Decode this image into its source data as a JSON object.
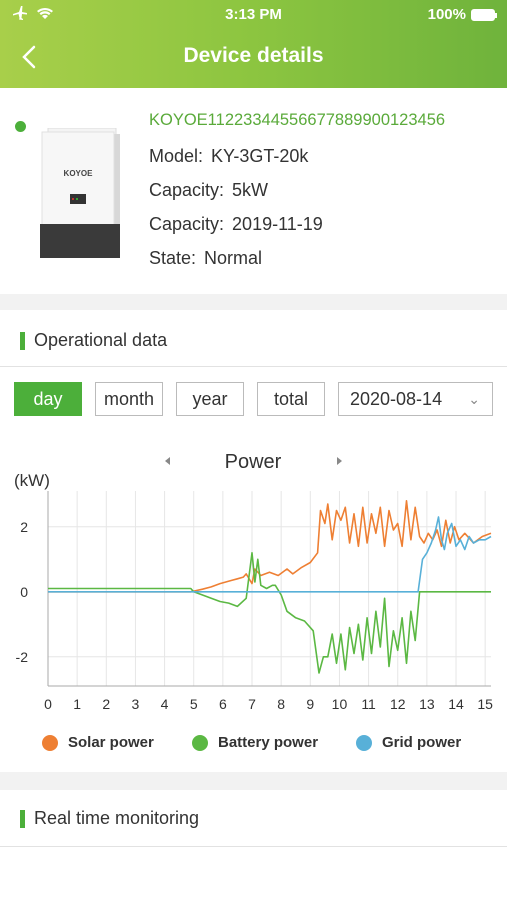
{
  "status_bar": {
    "time": "3:13 PM",
    "battery": "100%"
  },
  "header": {
    "title": "Device details"
  },
  "device": {
    "serial": "KOYOE11223344556677889900123456",
    "brand_logo": "KOYOE",
    "model_label": "Model:",
    "model": "KY-3GT-20k",
    "capacity_label": "Capacity:",
    "capacity": "5kW",
    "date_label": "Capacity:",
    "date": "2019-11-19",
    "state_label": "State:",
    "state": "Normal"
  },
  "operational": {
    "title": "Operational data",
    "tabs": [
      {
        "label": "day"
      },
      {
        "label": "month"
      },
      {
        "label": "year"
      },
      {
        "label": "total"
      }
    ],
    "date": "2020-08-14"
  },
  "chart_data": {
    "type": "line",
    "title": "Power",
    "ylabel": "(kW)",
    "xlim": [
      0,
      15.2
    ],
    "ylim": [
      -2.9,
      3.1
    ],
    "xticks": [
      0,
      1,
      2,
      3,
      4,
      5,
      6,
      7,
      8,
      9,
      10,
      11,
      12,
      13,
      14,
      15
    ],
    "yticks": [
      2,
      0,
      -2
    ],
    "grid": true,
    "legend": "bottom",
    "series": [
      {
        "name": "Solar power",
        "color": "#ee7f33",
        "points": [
          [
            0,
            0
          ],
          [
            4.9,
            0
          ],
          [
            5.0,
            0.02
          ],
          [
            5.3,
            0.08
          ],
          [
            5.6,
            0.15
          ],
          [
            5.9,
            0.25
          ],
          [
            6.1,
            0.3
          ],
          [
            6.3,
            0.35
          ],
          [
            6.5,
            0.4
          ],
          [
            6.7,
            0.45
          ],
          [
            6.8,
            0.55
          ],
          [
            7.0,
            0.25
          ],
          [
            7.1,
            0.7
          ],
          [
            7.3,
            0.5
          ],
          [
            7.6,
            0.6
          ],
          [
            7.9,
            0.5
          ],
          [
            8.2,
            0.7
          ],
          [
            8.4,
            0.55
          ],
          [
            8.7,
            0.75
          ],
          [
            9.0,
            0.9
          ],
          [
            9.25,
            1.2
          ],
          [
            9.35,
            2.5
          ],
          [
            9.5,
            2.1
          ],
          [
            9.6,
            2.7
          ],
          [
            9.75,
            1.6
          ],
          [
            9.9,
            2.5
          ],
          [
            10.05,
            2.2
          ],
          [
            10.2,
            2.6
          ],
          [
            10.35,
            1.5
          ],
          [
            10.5,
            2.4
          ],
          [
            10.65,
            1.4
          ],
          [
            10.8,
            2.6
          ],
          [
            10.95,
            1.5
          ],
          [
            11.1,
            2.4
          ],
          [
            11.25,
            1.8
          ],
          [
            11.4,
            2.6
          ],
          [
            11.55,
            1.4
          ],
          [
            11.7,
            2.5
          ],
          [
            11.85,
            1.9
          ],
          [
            12.0,
            2.1
          ],
          [
            12.15,
            1.4
          ],
          [
            12.3,
            2.8
          ],
          [
            12.45,
            1.6
          ],
          [
            12.6,
            2.6
          ],
          [
            12.75,
            1.7
          ],
          [
            12.9,
            1.5
          ],
          [
            13.05,
            1.8
          ],
          [
            13.2,
            1.6
          ],
          [
            13.35,
            1.9
          ],
          [
            13.5,
            1.4
          ],
          [
            13.65,
            2.2
          ],
          [
            13.8,
            1.5
          ],
          [
            13.95,
            2.0
          ],
          [
            14.1,
            1.6
          ],
          [
            14.3,
            1.8
          ],
          [
            14.6,
            1.5
          ],
          [
            14.9,
            1.7
          ],
          [
            15.2,
            1.8
          ]
        ]
      },
      {
        "name": "Battery power",
        "color": "#5bb843",
        "points": [
          [
            0,
            0.1
          ],
          [
            4.9,
            0.1
          ],
          [
            5.0,
            0
          ],
          [
            5.3,
            -0.1
          ],
          [
            5.6,
            -0.2
          ],
          [
            5.9,
            -0.3
          ],
          [
            6.2,
            -0.35
          ],
          [
            6.5,
            -0.45
          ],
          [
            6.8,
            -0.2
          ],
          [
            7.0,
            1.2
          ],
          [
            7.1,
            0.3
          ],
          [
            7.2,
            1.0
          ],
          [
            7.3,
            0.2
          ],
          [
            7.5,
            0.1
          ],
          [
            7.7,
            0.2
          ],
          [
            7.8,
            0.2
          ],
          [
            8.0,
            -0.1
          ],
          [
            8.2,
            -0.6
          ],
          [
            8.5,
            -0.8
          ],
          [
            8.8,
            -0.9
          ],
          [
            9.1,
            -1.2
          ],
          [
            9.3,
            -2.5
          ],
          [
            9.45,
            -2.0
          ],
          [
            9.6,
            -2.0
          ],
          [
            9.75,
            -1.3
          ],
          [
            9.9,
            -2.2
          ],
          [
            10.05,
            -1.3
          ],
          [
            10.2,
            -2.4
          ],
          [
            10.35,
            -1.1
          ],
          [
            10.5,
            -1.9
          ],
          [
            10.65,
            -1.0
          ],
          [
            10.8,
            -2.1
          ],
          [
            10.95,
            -0.8
          ],
          [
            11.1,
            -1.9
          ],
          [
            11.25,
            -0.6
          ],
          [
            11.4,
            -1.7
          ],
          [
            11.55,
            -0.2
          ],
          [
            11.7,
            -2.3
          ],
          [
            11.85,
            -1.2
          ],
          [
            12.0,
            -1.8
          ],
          [
            12.15,
            -0.8
          ],
          [
            12.3,
            -2.2
          ],
          [
            12.45,
            -0.6
          ],
          [
            12.6,
            -1.5
          ],
          [
            12.75,
            0
          ],
          [
            15.2,
            0
          ]
        ]
      },
      {
        "name": "Grid power",
        "color": "#58b0d8",
        "points": [
          [
            0,
            0
          ],
          [
            12.7,
            0
          ],
          [
            12.85,
            1.0
          ],
          [
            13.0,
            1.2
          ],
          [
            13.15,
            1.5
          ],
          [
            13.3,
            1.9
          ],
          [
            13.4,
            2.3
          ],
          [
            13.5,
            1.6
          ],
          [
            13.6,
            1.3
          ],
          [
            13.7,
            1.8
          ],
          [
            13.85,
            2.1
          ],
          [
            14.0,
            1.4
          ],
          [
            14.15,
            1.6
          ],
          [
            14.3,
            1.3
          ],
          [
            14.45,
            1.7
          ],
          [
            14.6,
            1.5
          ],
          [
            14.8,
            1.6
          ],
          [
            15.0,
            1.6
          ],
          [
            15.2,
            1.7
          ]
        ]
      }
    ]
  },
  "realtime": {
    "title": "Real time monitoring"
  }
}
